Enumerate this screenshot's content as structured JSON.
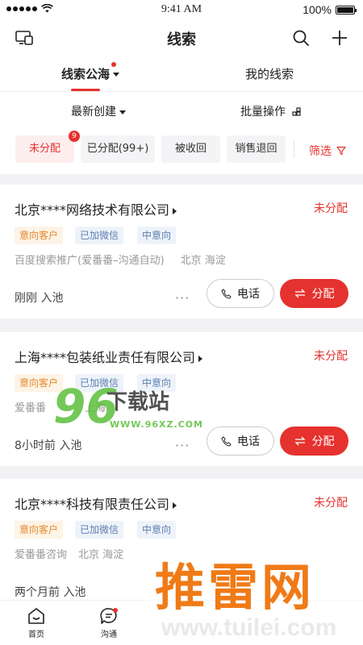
{
  "status_bar": {
    "time": "9:41 AM",
    "battery": "100%"
  },
  "nav": {
    "title": "线索"
  },
  "tabs": {
    "items": [
      {
        "label": "线索公海"
      },
      {
        "label": "我的线索"
      }
    ]
  },
  "sort": {
    "created_label": "最新创建",
    "batch_label": "批量操作"
  },
  "filters": {
    "chips": [
      {
        "label": "未分配",
        "badge": "9"
      },
      {
        "label": "已分配(99+)"
      },
      {
        "label": "被收回"
      },
      {
        "label": "销售退回"
      }
    ],
    "screen_label": "筛选"
  },
  "leads": [
    {
      "name": "北京****网络技术有限公司",
      "status": "未分配",
      "tags": [
        "意向客户",
        "已加微信",
        "中意向"
      ],
      "source": "百度搜索推广(爱番番–沟通自动)",
      "region": "北京 海淀",
      "time": "刚刚 入池",
      "call_label": "电话",
      "assign_label": "分配"
    },
    {
      "name": "上海****包装纸业责任有限公司",
      "status": "未分配",
      "tags": [
        "意向客户",
        "已加微信",
        "中意向"
      ],
      "source": "爱番番",
      "region": "上海",
      "time": "8小时前 入池",
      "call_label": "电话",
      "assign_label": "分配"
    },
    {
      "name": "北京****科技有限责任公司",
      "status": "未分配",
      "tags": [
        "意向客户",
        "已加微信",
        "中意向"
      ],
      "source": "爱番番咨询",
      "region": "北京 海淀",
      "time": "两个月前 入池"
    }
  ],
  "tabbar": {
    "items": [
      {
        "label": "首页"
      },
      {
        "label": "沟通"
      }
    ]
  },
  "watermarks": {
    "site96_digits": "96",
    "site96_name": "下载站",
    "site96_url": "WWW.96XZ.COM",
    "tuilei_name": "推雷网",
    "tuilei_url": "www.tuilei.com"
  },
  "colors": {
    "accent": "#e5322e",
    "tag_orange": "#e5892e",
    "tag_blue": "#5c7fb0"
  }
}
